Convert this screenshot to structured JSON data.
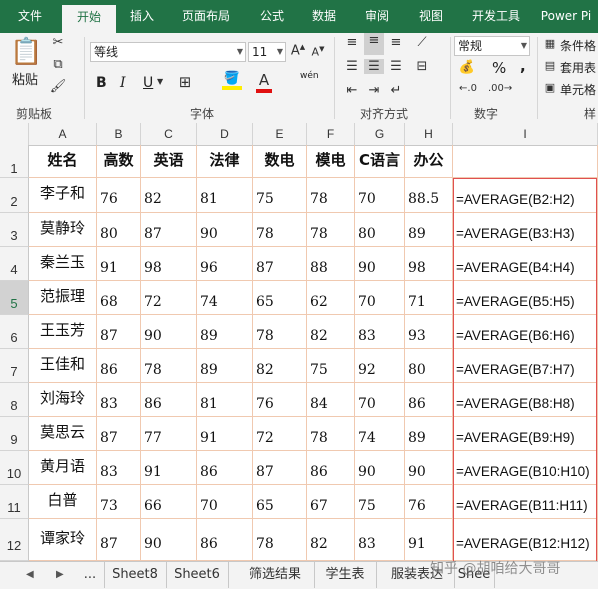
{
  "tabs": [
    "文件",
    "开始",
    "插入",
    "页面布局",
    "公式",
    "数据",
    "审阅",
    "视图",
    "开发工具",
    "Power Pi"
  ],
  "active_tab": "开始",
  "ribbon": {
    "clipboard_label": "剪贴板",
    "paste_label": "粘贴",
    "font_label": "字体",
    "font_name": "等线",
    "font_size": "11",
    "bold": "B",
    "italic": "I",
    "underline": "U",
    "wen": "wén",
    "align_label": "对齐方式",
    "number_label": "数字",
    "number_format": "常规",
    "style_label": "样",
    "cond_format": "条件格",
    "table_format": "套用表",
    "cell_style": "单元格",
    "percent": "%",
    "comma": ","
  },
  "columns": [
    "A",
    "B",
    "C",
    "D",
    "E",
    "F",
    "G",
    "H",
    "I"
  ],
  "rows": [
    "1",
    "2",
    "3",
    "4",
    "5",
    "6",
    "7",
    "8",
    "9",
    "10",
    "11",
    "12"
  ],
  "selected_row": "5",
  "headers": [
    "姓名",
    "高数",
    "英语",
    "法律",
    "数电",
    "模电",
    "C语言",
    "办公"
  ],
  "data": [
    {
      "name": "李子和",
      "vals": [
        "76",
        "82",
        "81",
        "75",
        "78",
        "70",
        "88.5"
      ],
      "fx": "=AVERAGE(B2:H2)"
    },
    {
      "name": "莫静玲",
      "vals": [
        "80",
        "87",
        "90",
        "78",
        "78",
        "80",
        "89"
      ],
      "fx": "=AVERAGE(B3:H3)"
    },
    {
      "name": "秦兰玉",
      "vals": [
        "91",
        "98",
        "96",
        "87",
        "88",
        "90",
        "98"
      ],
      "fx": "=AVERAGE(B4:H4)"
    },
    {
      "name": "范振理",
      "vals": [
        "68",
        "72",
        "74",
        "65",
        "62",
        "70",
        "71"
      ],
      "fx": "=AVERAGE(B5:H5)"
    },
    {
      "name": "王玉芳",
      "vals": [
        "87",
        "90",
        "89",
        "78",
        "82",
        "83",
        "93"
      ],
      "fx": "=AVERAGE(B6:H6)"
    },
    {
      "name": "王佳和",
      "vals": [
        "86",
        "78",
        "89",
        "82",
        "75",
        "92",
        "80"
      ],
      "fx": "=AVERAGE(B7:H7)"
    },
    {
      "name": "刘海玲",
      "vals": [
        "83",
        "86",
        "81",
        "76",
        "84",
        "70",
        "86"
      ],
      "fx": "=AVERAGE(B8:H8)"
    },
    {
      "name": "莫思云",
      "vals": [
        "87",
        "77",
        "91",
        "72",
        "78",
        "74",
        "89"
      ],
      "fx": "=AVERAGE(B9:H9)"
    },
    {
      "name": "黄月语",
      "vals": [
        "83",
        "91",
        "86",
        "87",
        "86",
        "90",
        "90"
      ],
      "fx": "=AVERAGE(B10:H10)"
    },
    {
      "name": "白普",
      "vals": [
        "73",
        "66",
        "70",
        "65",
        "67",
        "75",
        "76"
      ],
      "fx": "=AVERAGE(B11:H11)"
    },
    {
      "name": "谭家玲",
      "vals": [
        "87",
        "90",
        "86",
        "78",
        "82",
        "83",
        "91"
      ],
      "fx": "=AVERAGE(B12:H12)"
    }
  ],
  "sheets": [
    "...",
    "Sheet8",
    "Sheet6",
    "筛选结果",
    "学生表",
    "服装表达",
    "Shee"
  ],
  "watermark": "知乎 @胡咱给大哥哥"
}
